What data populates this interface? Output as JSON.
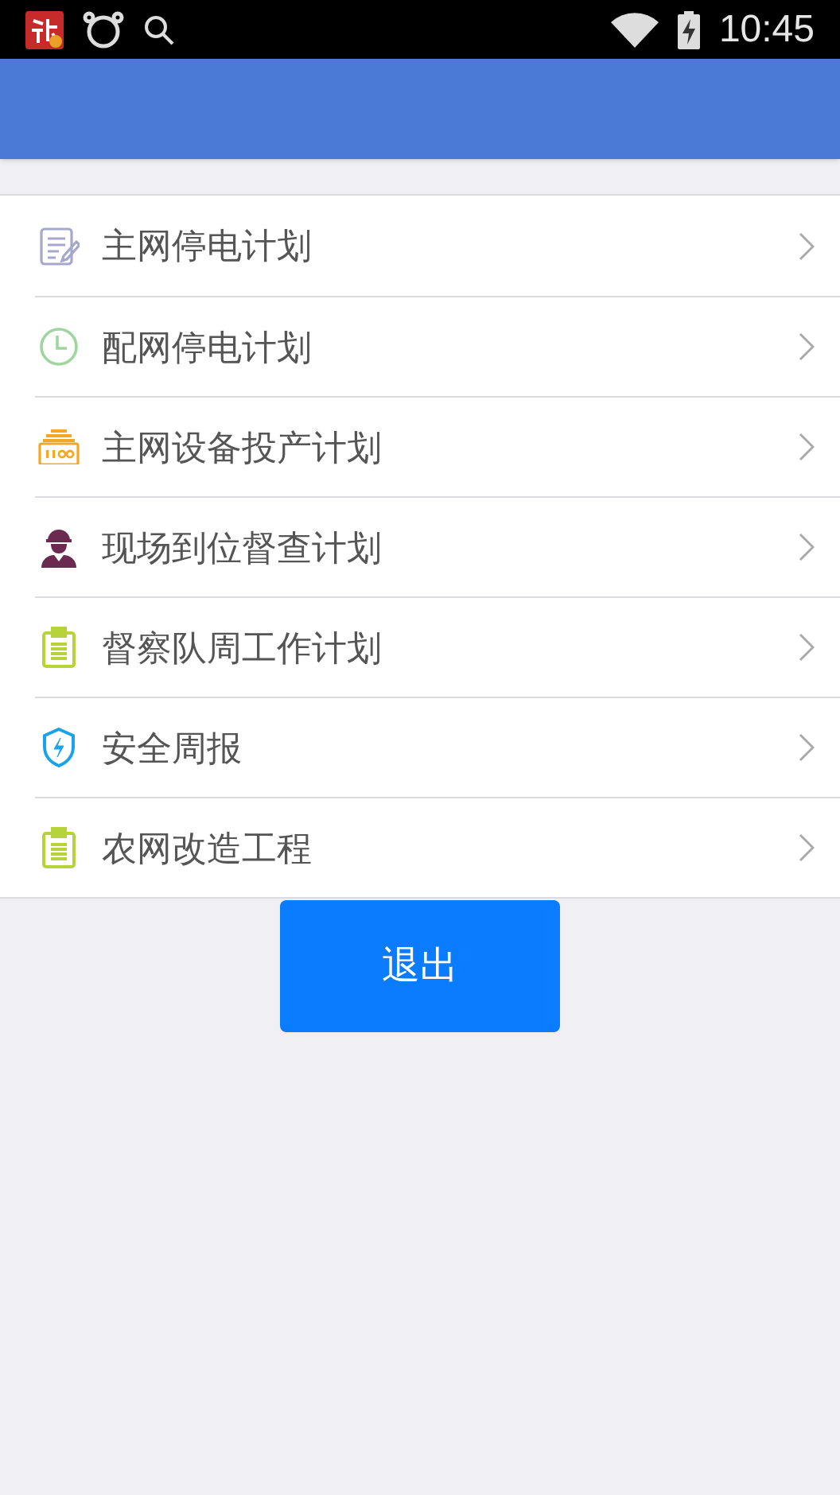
{
  "status_bar": {
    "time": "10:45"
  },
  "menu": [
    {
      "label": "主网停电计划",
      "kind": "document"
    },
    {
      "label": "配网停电计划",
      "kind": "clock"
    },
    {
      "label": "主网设备投产计划",
      "kind": "meter"
    },
    {
      "label": "现场到位督查计划",
      "kind": "worker"
    },
    {
      "label": "督察队周工作计划",
      "kind": "clipboard"
    },
    {
      "label": "安全周报",
      "kind": "shield"
    },
    {
      "label": "农网改造工程",
      "kind": "clipboard"
    }
  ],
  "logout_button": "退出"
}
